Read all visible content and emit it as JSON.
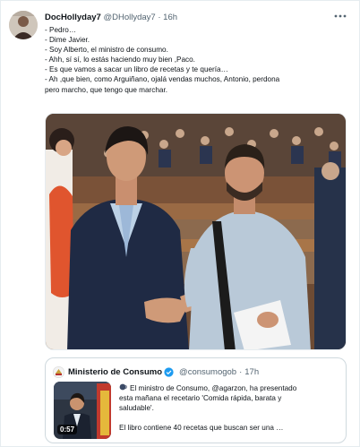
{
  "tweet": {
    "author_name": "DocHollyday7",
    "author_handle": "@DHollyday7",
    "dot": "·",
    "time": "16h",
    "lines": [
      "- Pedro…",
      "- Dime Javier.",
      "- Soy Alberto, el ministro de consumo.",
      "- Ahh, sí sí, lo estás haciendo muy bien ,Paco.",
      "- Es que vamos a sacar un libro de recetas y te quería…",
      "- Ah ,que bien, como Arguiñano, ojalá vendas muchos, Antonio, perdona",
      "pero marcho, que tengo que marchar."
    ]
  },
  "quote": {
    "name": "Ministerio de Consumo",
    "handle": "@consumogob",
    "dot": "·",
    "time": "17h",
    "text_lines": [
      "El ministro de Consumo, @agarzon, ha presentado",
      "esta mañana el recetario 'Comida rápida, barata y",
      "saludable'."
    ],
    "text_line2": "El libro contiene 40 recetas que buscan ser una …",
    "video_duration": "0:57"
  },
  "colors": {
    "text": "#0f1419",
    "secondary": "#536471",
    "border": "#cfd9de",
    "verified": "#1d9bf0"
  }
}
